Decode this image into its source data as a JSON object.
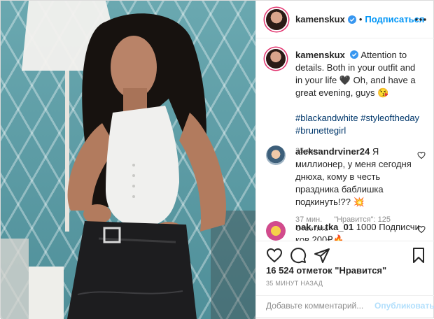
{
  "post": {
    "author": {
      "username": "kamenskux",
      "verified": true,
      "follow_label": "Подписаться",
      "separator": "•"
    },
    "caption": {
      "username": "kamenskux",
      "text": "Attention to details. Both in your outfit and in your life 🖤 Oh, and have a great evening, guys 😘",
      "hashtags": "#blackandwhite #styleoftheday #brunettegirl",
      "time": "35 мин."
    },
    "comments": [
      {
        "username": "aleksandrviner24",
        "text": "Я миллионер, у меня сегодня днюха, кому в честь праздника баблишка подкинуть!?? 💥",
        "time": "37 мин.",
        "likes": "\"Нравится\": 125",
        "reply": "Ответить"
      },
      {
        "username": "nak.ru.tka_01",
        "text": "1000 Подписчи ков 200₽🔥"
      }
    ],
    "icons": {
      "like": "heart-icon",
      "comment": "comment-icon",
      "share": "paper-plane-icon",
      "save": "bookmark-icon",
      "more": "more-icon",
      "verified": "verified-badge-icon"
    },
    "likes_text": "16 524 отметок \"Нравится\"",
    "posted_ago": "35 минут назад",
    "comment_input": {
      "placeholder": "Добавьте комментарий...",
      "publish_label": "Опубликовать"
    },
    "colors": {
      "accent": "#0095f6",
      "publish_disabled": "#b2dffc",
      "hashtag": "#00376b",
      "muted": "#8e8e8e",
      "story_ring": "#e1306c"
    }
  }
}
